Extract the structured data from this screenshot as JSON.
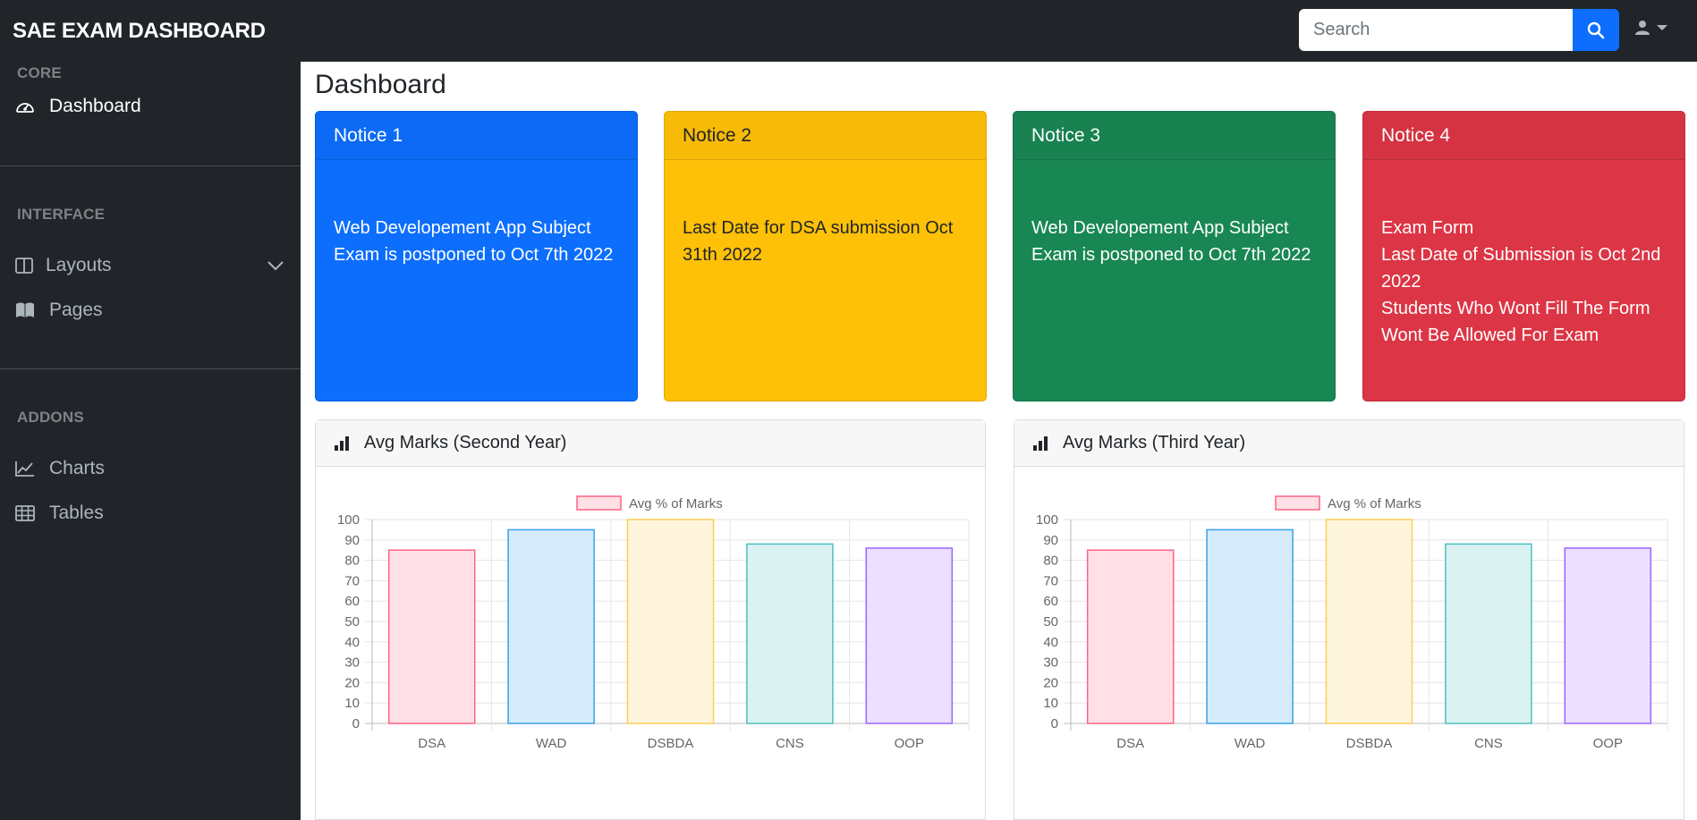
{
  "app": {
    "brand": "SAE EXAM DASHBOARD"
  },
  "search": {
    "placeholder": "Search"
  },
  "sidebar": {
    "sections": [
      {
        "heading": "CORE",
        "items": [
          {
            "label": "Dashboard",
            "icon": "speedometer-icon",
            "active": true
          }
        ]
      },
      {
        "heading": "INTERFACE",
        "items": [
          {
            "label": "Layouts",
            "icon": "columns-icon",
            "expandable": true
          },
          {
            "label": "Pages",
            "icon": "book-icon"
          }
        ]
      },
      {
        "heading": "ADDONS",
        "items": [
          {
            "label": "Charts",
            "icon": "chart-line-icon"
          },
          {
            "label": "Tables",
            "icon": "table-icon"
          }
        ]
      }
    ]
  },
  "main": {
    "title": "Dashboard",
    "notices": [
      {
        "title": "Notice 1",
        "color": "#0d6efd",
        "text_color": "#ffffff",
        "lines": [
          "Web Developement App Subject Exam is postponed to Oct 7th 2022"
        ]
      },
      {
        "title": "Notice 2",
        "color": "#ffc107",
        "text_color": "#212529",
        "lines": [
          "Last Date for DSA submission Oct 31th 2022"
        ]
      },
      {
        "title": "Notice 3",
        "color": "#198754",
        "text_color": "#ffffff",
        "lines": [
          "Web Developement App Subject Exam is postponed to Oct 7th 2022"
        ]
      },
      {
        "title": "Notice 4",
        "color": "#dc3545",
        "text_color": "#ffffff",
        "lines": [
          "Exam Form",
          "Last Date of Submission is Oct 2nd 2022",
          "Students Who Wont Fill The Form Wont Be Allowed For Exam"
        ]
      }
    ]
  },
  "chart_data": [
    {
      "type": "bar",
      "title": "Avg Marks (Second Year)",
      "categories": [
        "DSA",
        "WAD",
        "DSBDA",
        "CNS",
        "OOP"
      ],
      "series": [
        {
          "name": "Avg % of Marks",
          "values": [
            85,
            95,
            100,
            88,
            86
          ]
        }
      ],
      "bar_fill_colors": [
        "#ffe0e6",
        "#d7ecfb",
        "#fff5dd",
        "#dbf2f2",
        "#ebe0ff"
      ],
      "bar_border_colors": [
        "#ff6384",
        "#36a2eb",
        "#ffcd56",
        "#4bc0c0",
        "#9966ff"
      ],
      "ylim": [
        0,
        100
      ],
      "yticks": [
        0,
        10,
        20,
        30,
        40,
        50,
        60,
        70,
        80,
        90,
        100
      ],
      "grid": true,
      "legend": "top-center"
    },
    {
      "type": "bar",
      "title": "Avg Marks (Third Year)",
      "categories": [
        "DSA",
        "WAD",
        "DSBDA",
        "CNS",
        "OOP"
      ],
      "series": [
        {
          "name": "Avg % of Marks",
          "values": [
            85,
            95,
            100,
            88,
            86
          ]
        }
      ],
      "bar_fill_colors": [
        "#ffe0e6",
        "#d7ecfb",
        "#fff5dd",
        "#dbf2f2",
        "#ebe0ff"
      ],
      "bar_border_colors": [
        "#ff6384",
        "#36a2eb",
        "#ffcd56",
        "#4bc0c0",
        "#9966ff"
      ],
      "ylim": [
        0,
        100
      ],
      "yticks": [
        0,
        10,
        20,
        30,
        40,
        50,
        60,
        70,
        80,
        90,
        100
      ],
      "grid": true,
      "legend": "top-center"
    }
  ]
}
